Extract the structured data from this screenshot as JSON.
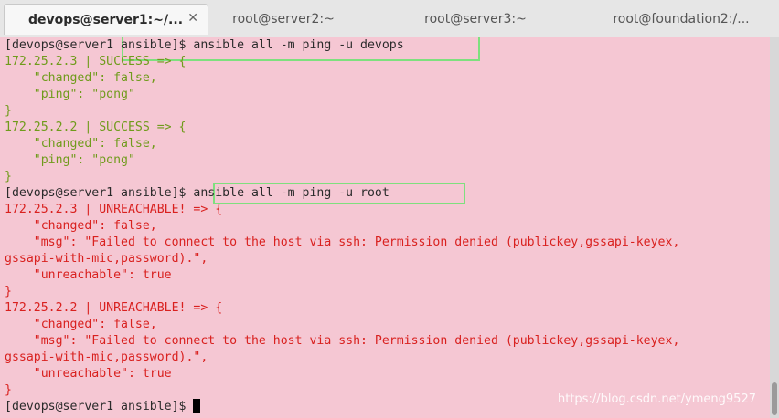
{
  "tabs": [
    {
      "label": "devops@server1:~/...",
      "active": true,
      "close": "✕"
    },
    {
      "label": "root@server2:~",
      "active": false
    },
    {
      "label": "root@server3:~",
      "active": false
    },
    {
      "label": "root@foundation2:/...",
      "active": false
    }
  ],
  "terminal": {
    "lines": [
      {
        "text": "[devops@server1 ansible]$ ansible all -m ping -u devops",
        "style": "prompt"
      },
      {
        "text": "172.25.2.3 | SUCCESS => {",
        "style": "ok"
      },
      {
        "text": "    \"changed\": false,",
        "style": "ok"
      },
      {
        "text": "    \"ping\": \"pong\"",
        "style": "ok"
      },
      {
        "text": "}",
        "style": "ok"
      },
      {
        "text": "172.25.2.2 | SUCCESS => {",
        "style": "ok"
      },
      {
        "text": "    \"changed\": false,",
        "style": "ok"
      },
      {
        "text": "    \"ping\": \"pong\"",
        "style": "ok"
      },
      {
        "text": "}",
        "style": "ok"
      },
      {
        "text": "[devops@server1 ansible]$ ansible all -m ping -u root",
        "style": "prompt"
      },
      {
        "text": "172.25.2.3 | UNREACHABLE! => {",
        "style": "err"
      },
      {
        "text": "    \"changed\": false,",
        "style": "err"
      },
      {
        "text": "    \"msg\": \"Failed to connect to the host via ssh: Permission denied (publickey,gssapi-keyex,",
        "style": "err"
      },
      {
        "text": "gssapi-with-mic,password).\",",
        "style": "err"
      },
      {
        "text": "    \"unreachable\": true",
        "style": "err"
      },
      {
        "text": "}",
        "style": "err"
      },
      {
        "text": "172.25.2.2 | UNREACHABLE! => {",
        "style": "err"
      },
      {
        "text": "    \"changed\": false,",
        "style": "err"
      },
      {
        "text": "    \"msg\": \"Failed to connect to the host via ssh: Permission denied (publickey,gssapi-keyex,",
        "style": "err"
      },
      {
        "text": "gssapi-with-mic,password).\",",
        "style": "err"
      },
      {
        "text": "    \"unreachable\": true",
        "style": "err"
      },
      {
        "text": "}",
        "style": "err"
      },
      {
        "text": "[devops@server1 ansible]$ ",
        "style": "prompt",
        "cursor": true
      }
    ]
  },
  "watermark": "https://blog.csdn.net/ymeng9527",
  "colors": {
    "background": "#f5c7d3",
    "success": "#6f9b1b",
    "error": "#d9211f",
    "prompt": "#2b2b2b",
    "highlight_box": "#7ee07e"
  }
}
